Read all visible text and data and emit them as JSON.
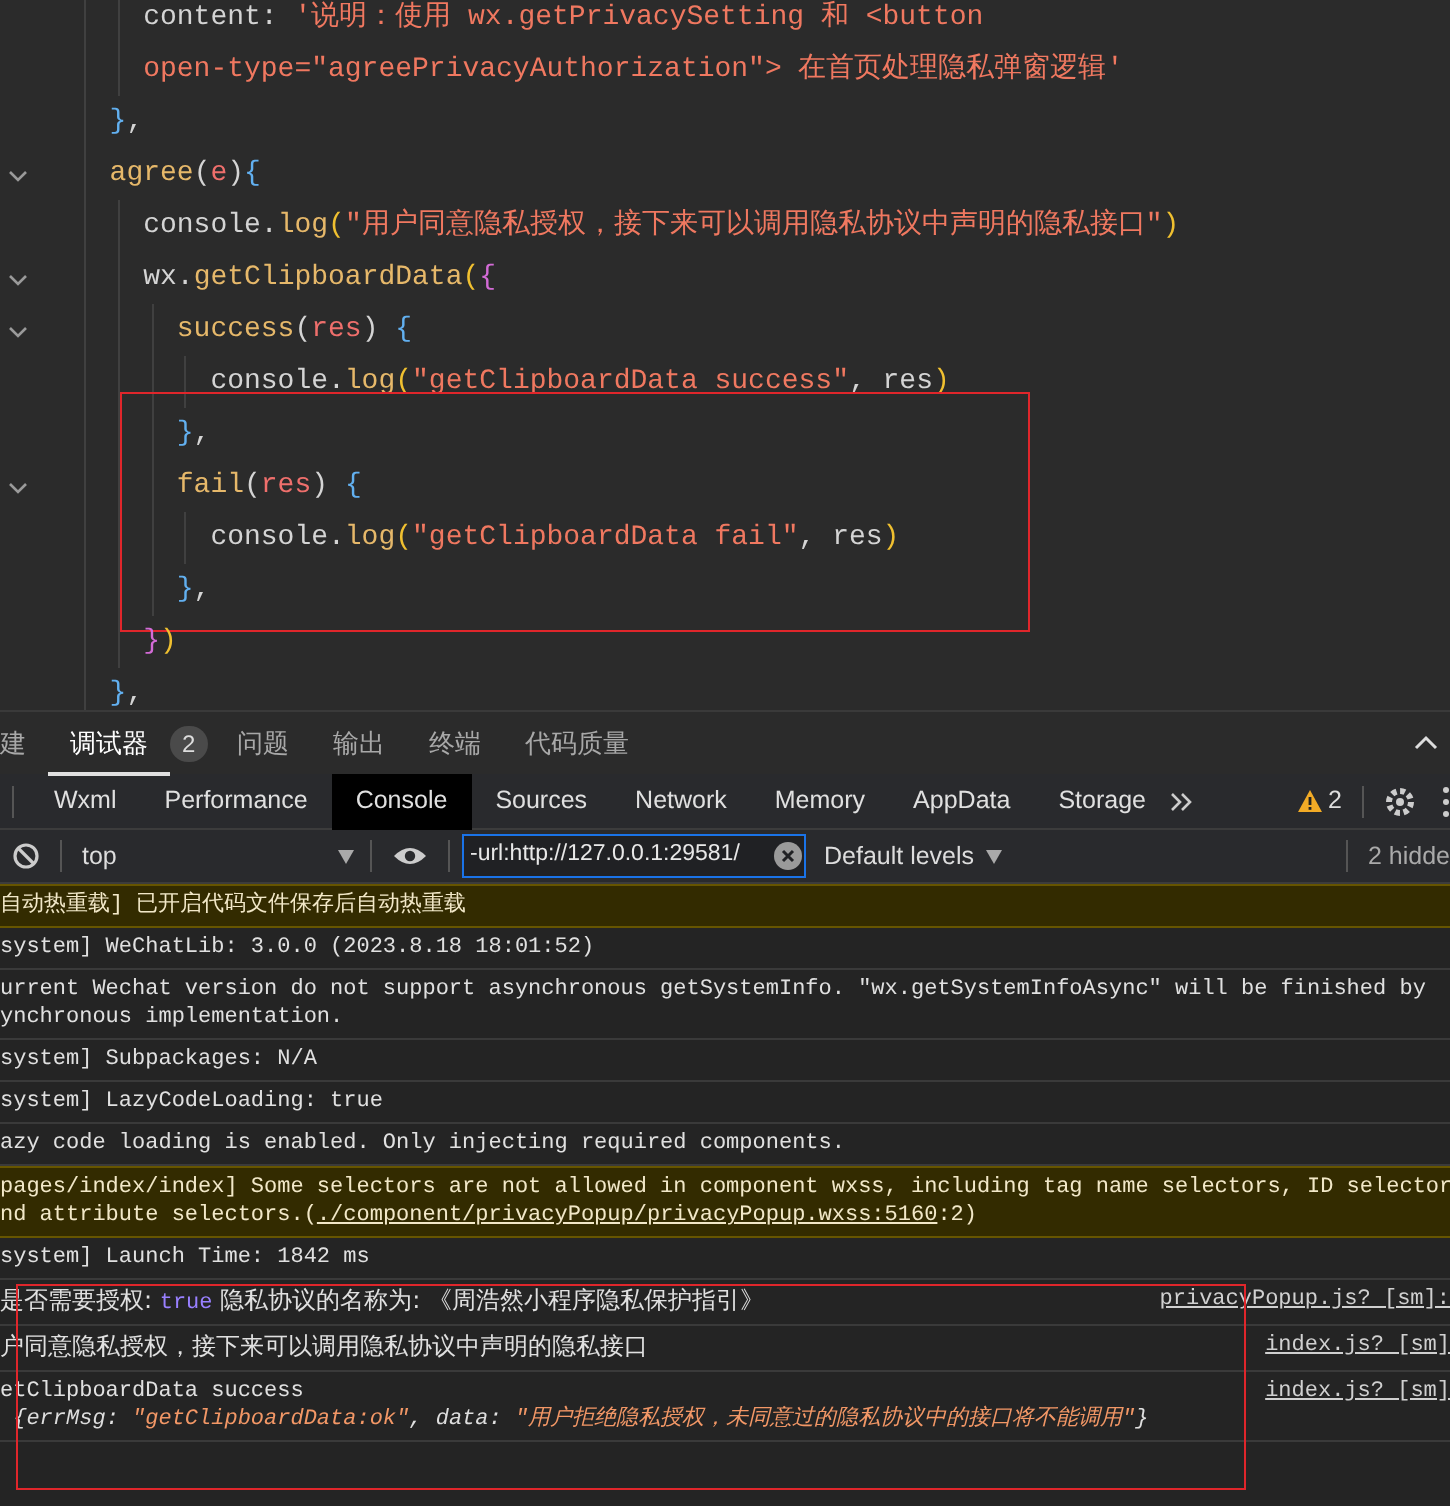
{
  "editor": {
    "lines": [
      {
        "children": [
          {
            "boxed": false,
            "tokens": [
              {
                "kind": "plain",
                "text": "content: "
              },
              {
                "kind": "string",
                "text": "'说明：使用 wx.getPrivacySetting 和 <button"
              }
            ]
          },
          {
            "boxed": false,
            "tokens": [
              {
                "kind": "string",
                "text": "open-type=\"agreePrivacyAuthorization\"> 在首页处理隐私弹窗逻辑'"
              }
            ]
          }
        ]
      },
      {
        "boxed": false,
        "tokens": [
          {
            "kind": "brace",
            "text": "}"
          },
          {
            "kind": "plain",
            "text": ","
          }
        ]
      },
      {
        "boxed": false,
        "tokens": [
          {
            "kind": "func",
            "text": "agree"
          },
          {
            "kind": "plain",
            "text": "("
          },
          {
            "kind": "param",
            "text": "e"
          },
          {
            "kind": "plain",
            "text": ")"
          },
          {
            "kind": "brace",
            "text": "{"
          }
        ],
        "children": [
          {
            "boxed": false,
            "tokens": [
              {
                "kind": "plain",
                "text": "console."
              },
              {
                "kind": "func",
                "text": "log"
              },
              {
                "kind": "paren",
                "text": "("
              },
              {
                "kind": "string",
                "text": "\"用户同意隐私授权，接下来可以调用隐私协议中声明的隐私接口\""
              },
              {
                "kind": "paren",
                "text": ")"
              }
            ]
          },
          {
            "boxed": false,
            "tokens": [
              {
                "kind": "plain",
                "text": "wx."
              },
              {
                "kind": "func",
                "text": "getClipboardData"
              },
              {
                "kind": "paren",
                "text": "("
              },
              {
                "kind": "curly",
                "text": "{"
              }
            ],
            "children": [
              {
                "boxed": false,
                "tokens": [
                  {
                    "kind": "func",
                    "text": "success"
                  },
                  {
                    "kind": "plain",
                    "text": "("
                  },
                  {
                    "kind": "param",
                    "text": "res"
                  },
                  {
                    "kind": "plain",
                    "text": ") "
                  },
                  {
                    "kind": "brace",
                    "text": "{"
                  }
                ],
                "children": [
                  {
                    "boxed": false,
                    "tokens": [
                      {
                        "kind": "plain",
                        "text": "console."
                      },
                      {
                        "kind": "func",
                        "text": "log"
                      },
                      {
                        "kind": "paren",
                        "text": "("
                      },
                      {
                        "kind": "string",
                        "text": "\"getClipboardData success\""
                      },
                      {
                        "kind": "plain",
                        "text": ", res"
                      },
                      {
                        "kind": "paren",
                        "text": ")"
                      }
                    ]
                  }
                ]
              },
              {
                "boxed": true,
                "tokens": [
                  {
                    "kind": "brace",
                    "text": "}"
                  },
                  {
                    "kind": "plain",
                    "text": ","
                  }
                ]
              },
              {
                "boxed": true,
                "tokens": [
                  {
                    "kind": "func",
                    "text": "fail"
                  },
                  {
                    "kind": "plain",
                    "text": "("
                  },
                  {
                    "kind": "param",
                    "text": "res"
                  },
                  {
                    "kind": "plain",
                    "text": ") "
                  },
                  {
                    "kind": "brace",
                    "text": "{"
                  }
                ],
                "children": [
                  {
                    "boxed": true,
                    "tokens": [
                      {
                        "kind": "plain",
                        "text": "console."
                      },
                      {
                        "kind": "func",
                        "text": "log"
                      },
                      {
                        "kind": "paren",
                        "text": "("
                      },
                      {
                        "kind": "string",
                        "text": "\"getClipboardData fail\""
                      },
                      {
                        "kind": "plain",
                        "text": ", res"
                      },
                      {
                        "kind": "paren",
                        "text": ")"
                      }
                    ]
                  }
                ]
              },
              {
                "boxed": true,
                "tokens": [
                  {
                    "kind": "brace",
                    "text": "}"
                  },
                  {
                    "kind": "plain",
                    "text": ","
                  }
                ]
              }
            ]
          },
          {
            "boxed": false,
            "tokens": [
              {
                "kind": "curly",
                "text": "}"
              },
              {
                "kind": "paren",
                "text": ")"
              }
            ]
          }
        ]
      },
      {
        "boxed": false,
        "tokens": [
          {
            "kind": "brace",
            "text": "}"
          },
          {
            "kind": "plain",
            "text": ","
          }
        ]
      }
    ]
  },
  "panel_tabs": [
    {
      "label": "建",
      "selected": false
    },
    {
      "label": "调试器",
      "selected": true,
      "badge": "2"
    },
    {
      "label": "问题",
      "selected": false
    },
    {
      "label": "输出",
      "selected": false
    },
    {
      "label": "终端",
      "selected": false
    },
    {
      "label": "代码质量",
      "selected": false
    }
  ],
  "devtools_tabs": [
    {
      "label": "Wxml",
      "selected": false
    },
    {
      "label": "Performance",
      "selected": false
    },
    {
      "label": "Console",
      "selected": true
    },
    {
      "label": "Sources",
      "selected": false
    },
    {
      "label": "Network",
      "selected": false
    },
    {
      "label": "Memory",
      "selected": false
    },
    {
      "label": "AppData",
      "selected": false
    },
    {
      "label": "Storage",
      "selected": false
    }
  ],
  "warning_count": "2",
  "filter": {
    "context": "top",
    "value": "-url:http://127.0.0.1:29581/",
    "levels": "Default levels",
    "hidden": "2 hidde"
  },
  "messages": [
    {
      "kind": "warning",
      "boxed": false,
      "lines": [
        [
          {
            "kind": "text",
            "text": "自动热重载] 已开启代码文件保存后自动热重载"
          }
        ]
      ]
    },
    {
      "kind": "info",
      "boxed": false,
      "lines": [
        [
          {
            "kind": "text",
            "text": "system] WeChatLib: 3.0.0 (2023.8.18 18:01:52)"
          }
        ]
      ]
    },
    {
      "kind": "info",
      "boxed": false,
      "lines": [
        [
          {
            "kind": "text",
            "text": "urrent Wechat version do not support asynchronous getSystemInfo. \"wx.getSystemInfoAsync\" will be finished by"
          }
        ],
        [
          {
            "kind": "text",
            "text": "ynchronous implementation."
          }
        ]
      ]
    },
    {
      "kind": "info",
      "boxed": false,
      "lines": [
        [
          {
            "kind": "text",
            "text": "system] Subpackages: N/A"
          }
        ]
      ]
    },
    {
      "kind": "info",
      "boxed": false,
      "lines": [
        [
          {
            "kind": "text",
            "text": "system] LazyCodeLoading: true"
          }
        ]
      ]
    },
    {
      "kind": "info",
      "boxed": false,
      "lines": [
        [
          {
            "kind": "text",
            "text": "azy code loading is enabled. Only injecting required components."
          }
        ]
      ]
    },
    {
      "kind": "warning",
      "boxed": false,
      "lines": [
        [
          {
            "kind": "text",
            "text": "pages/index/index] Some selectors are not allowed in component wxss, including tag name selectors, ID selector"
          }
        ],
        [
          {
            "kind": "text",
            "text": "nd attribute selectors.("
          },
          {
            "kind": "link",
            "text": "./component/privacyPopup/privacyPopup.wxss:5160"
          },
          {
            "kind": "text",
            "text": ":2)"
          }
        ]
      ]
    },
    {
      "kind": "info",
      "boxed": false,
      "lines": [
        [
          {
            "kind": "text",
            "text": "system] Launch Time: 1842 ms"
          }
        ]
      ]
    },
    {
      "kind": "info",
      "boxed": true,
      "source": "privacyPopup.js? [sm]:",
      "lines": [
        [
          {
            "kind": "cjk",
            "text": "是否需要授权: "
          },
          {
            "kind": "boolean",
            "text": "true"
          },
          {
            "kind": "cjk",
            "text": " 隐私协议的名称为: 《周浩然小程序隐私保护指引》"
          }
        ]
      ]
    },
    {
      "kind": "info",
      "boxed": true,
      "source": "index.js? [sm]",
      "lines": [
        [
          {
            "kind": "cjk",
            "text": "户同意隐私授权，接下来可以调用隐私协议中声明的隐私接口"
          }
        ]
      ]
    },
    {
      "kind": "info",
      "boxed": true,
      "source": "index.js? [sm]",
      "lines": [
        [
          {
            "kind": "text",
            "text": "etClipboardData success"
          }
        ],
        [
          {
            "kind": "punct",
            "text": " {"
          },
          {
            "kind": "key",
            "text": "errMsg"
          },
          {
            "kind": "punct",
            "text": ": "
          },
          {
            "kind": "string",
            "text": "\"getClipboardData:ok\""
          },
          {
            "kind": "punct",
            "text": ", "
          },
          {
            "kind": "key",
            "text": "data"
          },
          {
            "kind": "punct",
            "text": ": "
          },
          {
            "kind": "string",
            "text": "\"用户拒绝隐私授权，未同意过的隐私协议中的接口将不能调用\""
          },
          {
            "kind": "punct",
            "text": "}"
          }
        ]
      ]
    }
  ]
}
